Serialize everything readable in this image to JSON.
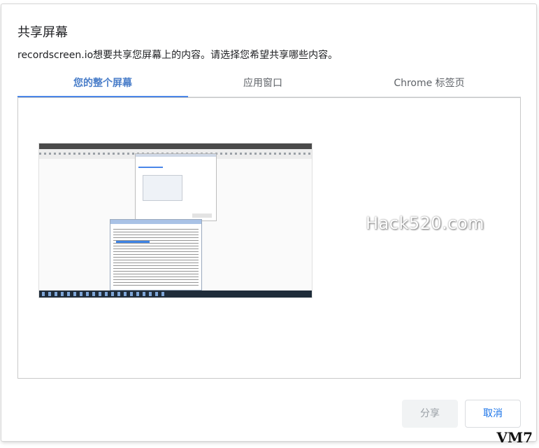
{
  "dialog": {
    "title": "共享屏幕",
    "subtitle": "recordscreen.io想要共享您屏幕上的内容。请选择您希望共享哪些内容。",
    "tabs": [
      {
        "label": "您的整个屏幕",
        "active": true
      },
      {
        "label": "应用窗口",
        "active": false
      },
      {
        "label": "Chrome 标签页",
        "active": false
      }
    ],
    "watermark": "Hack520.com",
    "buttons": {
      "share": "分享",
      "cancel": "取消"
    }
  },
  "corner_tag": "VM7",
  "colors": {
    "accent": "#4a86e8",
    "active_tab_text": "#4a7ec9",
    "cancel_text": "#1a73e8",
    "disabled_text": "#9aa0a6"
  }
}
